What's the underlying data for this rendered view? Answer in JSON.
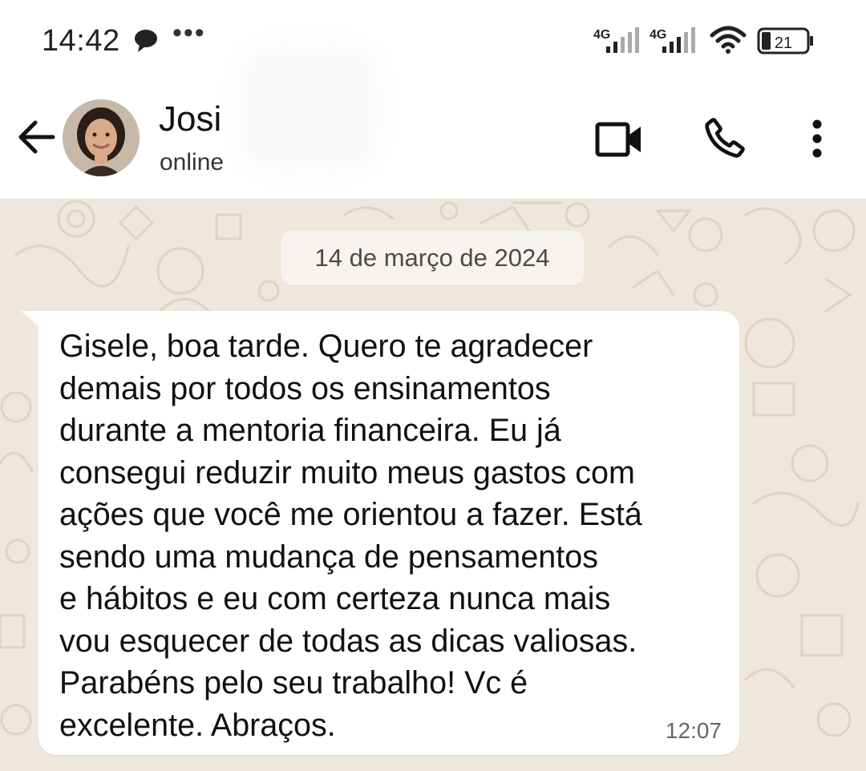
{
  "status_bar": {
    "time": "14:42",
    "more": "•••",
    "network_1": "4G",
    "network_2": "4G",
    "battery": "21"
  },
  "header": {
    "contact_name": "Josi",
    "contact_status": "online",
    "icons": [
      "back-arrow-icon",
      "video-call-icon",
      "phone-icon",
      "more-vertical-icon"
    ]
  },
  "chat": {
    "date_label": "14 de março de 2024",
    "messages": [
      {
        "text": "Gisele, boa tarde. Quero te agradecer\ndemais por todos os ensinamentos\ndurante a mentoria financeira. Eu já\nconsegui reduzir muito meus gastos com\nações que você me orientou a fazer. Está\nsendo uma mudança de pensamentos\ne hábitos e eu com certeza nunca mais\nvou esquecer de todas as dicas valiosas.\nParabéns pelo seu trabalho! Vc é\nexcelente. Abraços.",
        "time": "12:07"
      }
    ]
  },
  "colors": {
    "chat_background": "#efe7dc",
    "bubble": "#ffffff",
    "date_chip": "#f7f3ef",
    "wallpaper_doodle": "#e3d7c6"
  }
}
